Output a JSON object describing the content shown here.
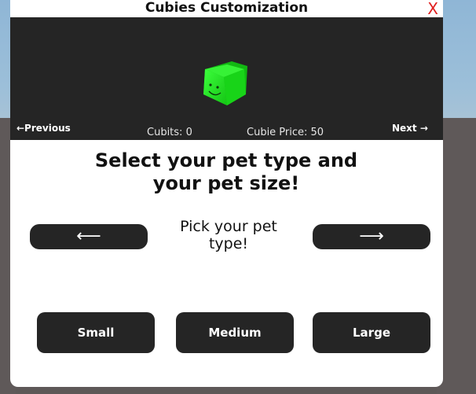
{
  "window": {
    "title": "Cubies Customization",
    "close_label": "X"
  },
  "preview": {
    "previous_label": "←Previous",
    "next_label": "Next →",
    "cubits_text": "Cubits: 0",
    "price_text": "Cubie Price: 50",
    "pet_color": "#1fe61f"
  },
  "main": {
    "heading_line1": "Select your pet type and",
    "heading_line2": "your pet size!",
    "pick_label_line1": "Pick your pet",
    "pick_label_line2": "type!",
    "left_arrow": "⟵",
    "right_arrow": "⟶"
  },
  "sizes": {
    "small": "Small",
    "medium": "Medium",
    "large": "Large"
  },
  "colors": {
    "panel_dark": "#252525",
    "close_red": "#e02020"
  }
}
